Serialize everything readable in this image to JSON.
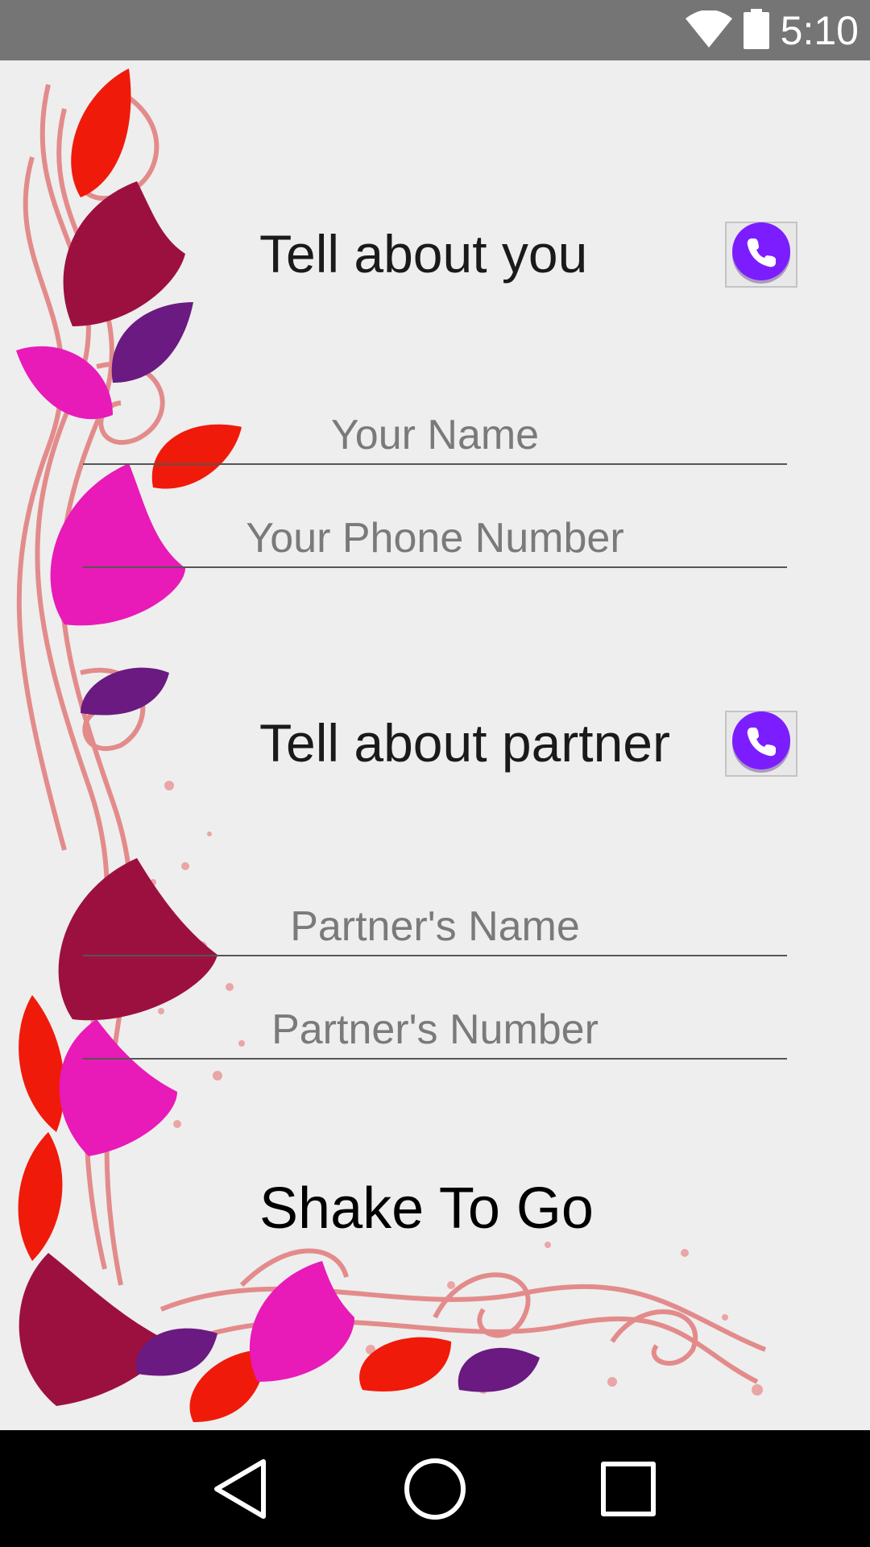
{
  "status_bar": {
    "time": "5:10",
    "icons": [
      "wifi-icon",
      "battery-icon"
    ]
  },
  "section_you": {
    "title": "Tell about you",
    "contact_button_icon": "phone-icon"
  },
  "your_name": {
    "placeholder": "Your Name",
    "value": ""
  },
  "your_phone": {
    "placeholder": "Your Phone Number",
    "value": ""
  },
  "section_partner": {
    "title": "Tell about partner",
    "contact_button_icon": "phone-icon"
  },
  "partner_name": {
    "placeholder": "Partner's Name",
    "value": ""
  },
  "partner_number": {
    "placeholder": "Partner's Number",
    "value": ""
  },
  "shake": {
    "label": "Shake To Go"
  },
  "nav_bar": {
    "buttons": [
      "back-icon",
      "home-icon",
      "recents-icon"
    ]
  },
  "colors": {
    "status_bar": "#757575",
    "background": "#eeeeee",
    "accent_purple": "#7c1dff",
    "leaf_red": "#f01a0a",
    "leaf_magenta": "#e81ab8",
    "leaf_maroon": "#9c1040",
    "leaf_purple": "#6a1a80"
  }
}
